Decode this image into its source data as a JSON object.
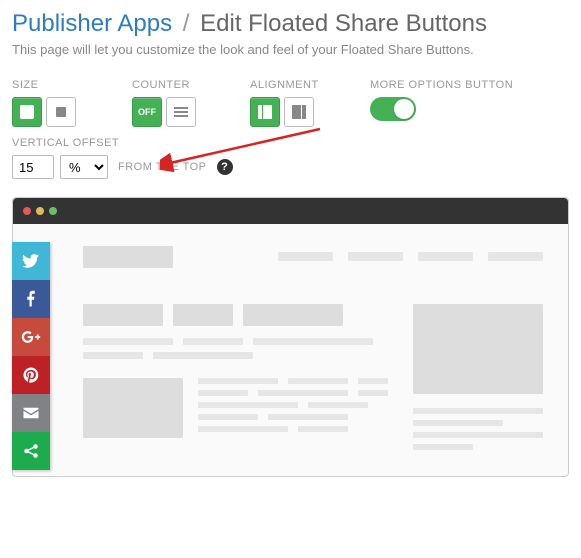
{
  "breadcrumb": {
    "root": "Publisher Apps",
    "sep": "/",
    "current": "Edit Floated Share Buttons"
  },
  "description": "This page will let you customize the look and feel of your Floated Share Buttons.",
  "options": {
    "size_label": "SIZE",
    "counter_label": "COUNTER",
    "counter_off": "OFF",
    "alignment_label": "ALIGNMENT",
    "more_label": "MORE OPTIONS BUTTON"
  },
  "vertical_offset": {
    "label": "VERTICAL OFFSET",
    "value": "15",
    "unit": "%",
    "suffix": "FROM THE TOP",
    "help": "?"
  }
}
